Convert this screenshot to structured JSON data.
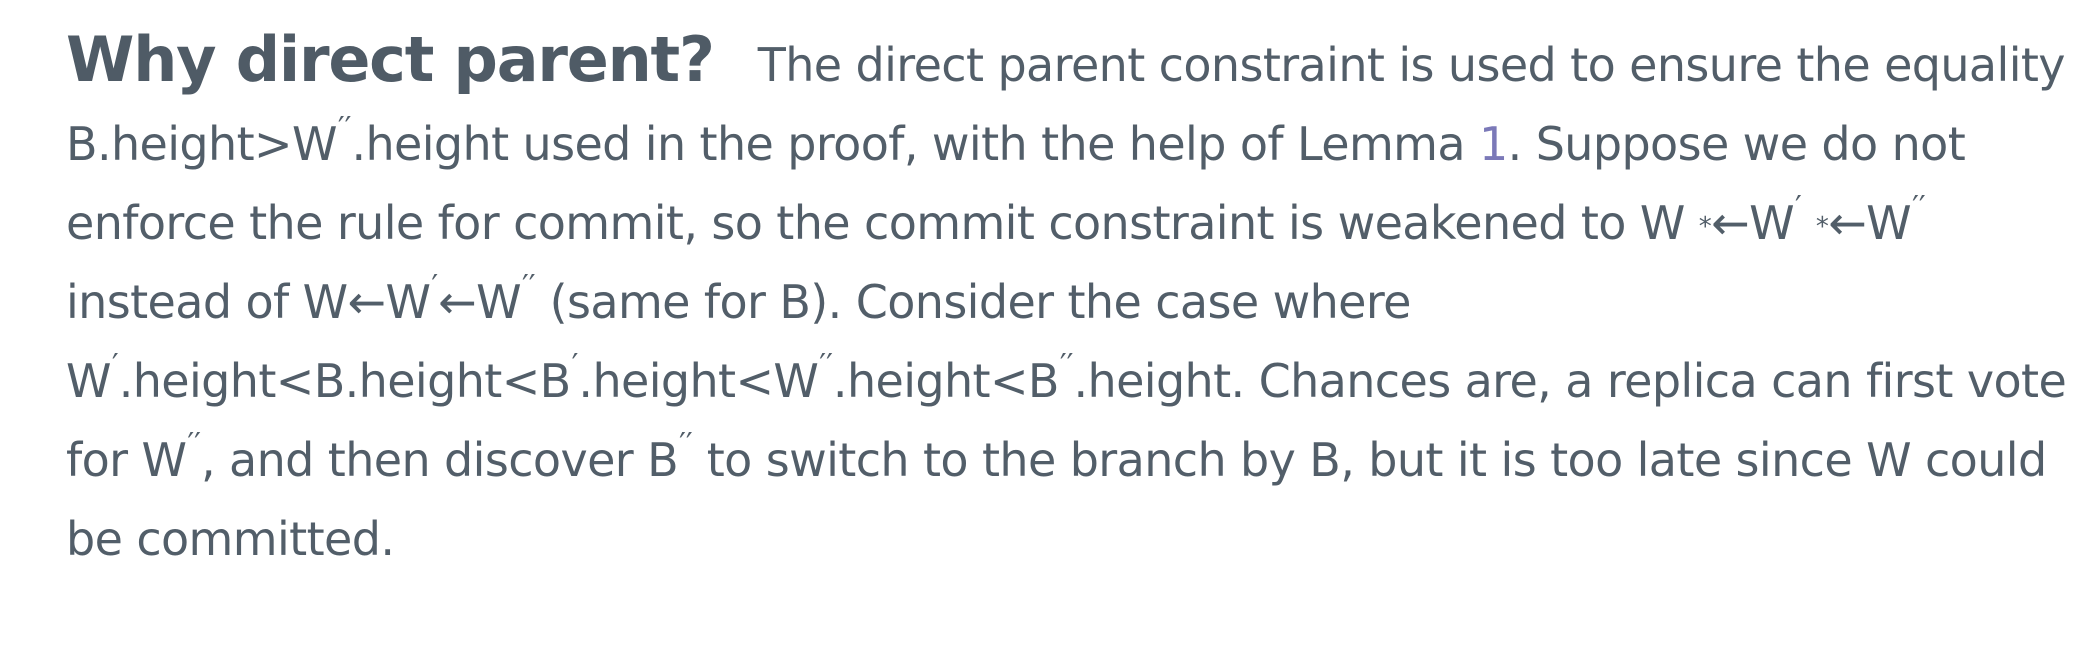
{
  "section": {
    "heading": "Why direct parent?"
  },
  "text": {
    "p1": "The direct parent constraint is used to ensure the equality B.height>W",
    "p2": ".height used in the proof, with the help of Lemma ",
    "lemma_ref": "1",
    "p3": ". Suppose we do not enforce the rule for commit, so the commit constraint is weakened to W",
    "p4": "W",
    "p5": "W",
    "p6": " instead of W",
    "p7": "W",
    "p8": "W",
    "p9": " (same for B). Consider the case where W",
    "p10": ".height<B.height<B",
    "p11": ".height<W",
    "p12": ".height<B",
    "p13": ".height. Chances are, a replica can first vote for W",
    "p14": ", and then discover B",
    "p15": " to switch to the branch by B, but it is too late since W",
    "p16": " could be committed."
  },
  "symbols": {
    "prime": "′",
    "double_prime": "′′",
    "star": "*",
    "arrow": "←"
  }
}
